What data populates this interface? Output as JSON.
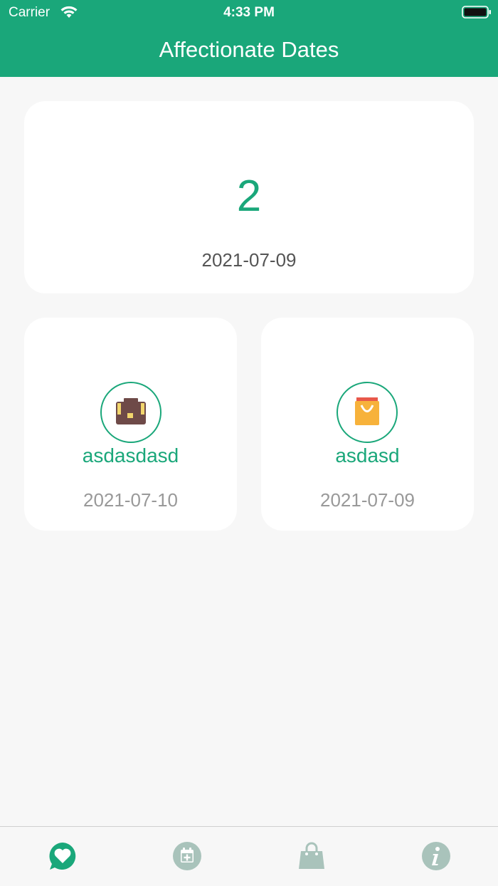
{
  "status_bar": {
    "carrier": "Carrier",
    "time": "4:33 PM"
  },
  "header": {
    "title": "Affectionate Dates"
  },
  "summary": {
    "count": "2",
    "date": "2021-07-09"
  },
  "items": [
    {
      "name": "asdasdasd",
      "date": "2021-07-10",
      "icon": "briefcase-icon"
    },
    {
      "name": "asdasd",
      "date": "2021-07-09",
      "icon": "shopping-bag-icon"
    }
  ],
  "tabbar": {
    "tabs": [
      {
        "icon": "heart-chat-icon",
        "active": true
      },
      {
        "icon": "calendar-add-icon",
        "active": false
      },
      {
        "icon": "bag-icon",
        "active": false
      },
      {
        "icon": "info-icon",
        "active": false
      }
    ]
  },
  "colors": {
    "accent": "#1aa77a",
    "inactive_tab": "#a9c3bb",
    "background": "#f7f7f7"
  }
}
